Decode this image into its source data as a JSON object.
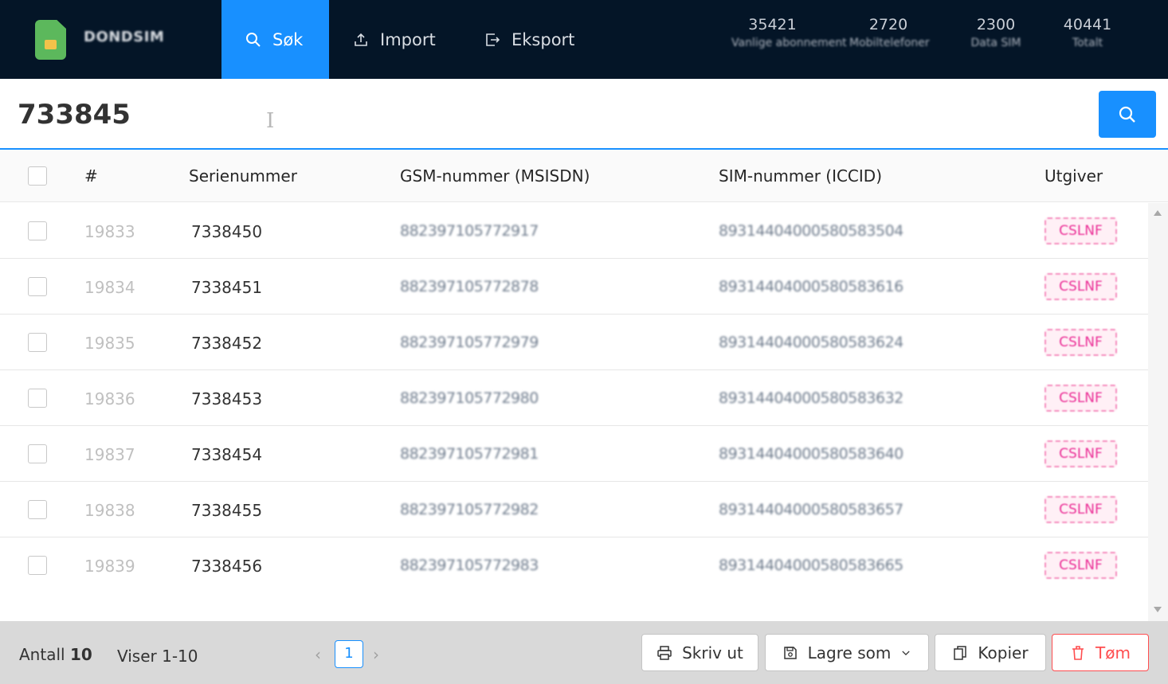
{
  "header": {
    "brand": "DONDSIM",
    "nav": [
      {
        "label": "Søk",
        "icon": "search-icon"
      },
      {
        "label": "Import",
        "icon": "upload-icon"
      },
      {
        "label": "Eksport",
        "icon": "export-icon"
      }
    ],
    "stats": [
      {
        "value": "35421",
        "label": "Vanlige abonnement"
      },
      {
        "value": "2720",
        "label": "Mobiltelefoner"
      },
      {
        "value": "2300",
        "label": "Data SIM"
      },
      {
        "value": "40441",
        "label": "Totalt"
      }
    ]
  },
  "search": {
    "value": "733845",
    "button_icon": "search-icon"
  },
  "table": {
    "columns": [
      "#",
      "Serienummer",
      "GSM-nummer (MSISDN)",
      "SIM-nummer (ICCID)",
      "Utgiver"
    ],
    "rows": [
      {
        "idx": "19833",
        "serial": "7338450",
        "msisdn": "882397105772917",
        "iccid": "89314404000580583504",
        "issuer": "CSLNF"
      },
      {
        "idx": "19834",
        "serial": "7338451",
        "msisdn": "882397105772878",
        "iccid": "89314404000580583616",
        "issuer": "CSLNF"
      },
      {
        "idx": "19835",
        "serial": "7338452",
        "msisdn": "882397105772979",
        "iccid": "89314404000580583624",
        "issuer": "CSLNF"
      },
      {
        "idx": "19836",
        "serial": "7338453",
        "msisdn": "882397105772980",
        "iccid": "89314404000580583632",
        "issuer": "CSLNF"
      },
      {
        "idx": "19837",
        "serial": "7338454",
        "msisdn": "882397105772981",
        "iccid": "89314404000580583640",
        "issuer": "CSLNF"
      },
      {
        "idx": "19838",
        "serial": "7338455",
        "msisdn": "882397105772982",
        "iccid": "89314404000580583657",
        "issuer": "CSLNF"
      },
      {
        "idx": "19839",
        "serial": "7338456",
        "msisdn": "882397105772983",
        "iccid": "89314404000580583665",
        "issuer": "CSLNF"
      }
    ]
  },
  "footer": {
    "count_label": "Antall",
    "count_value": "10",
    "showing": "Viser 1-10",
    "current_page": "1",
    "buttons": {
      "print": "Skriv ut",
      "save_as": "Lagre som",
      "copy": "Kopier",
      "clear": "Tøm"
    }
  },
  "colors": {
    "header_bg": "#041527",
    "accent": "#1890ff",
    "tag_color": "#eb2f96",
    "danger": "#ff4d4f"
  }
}
